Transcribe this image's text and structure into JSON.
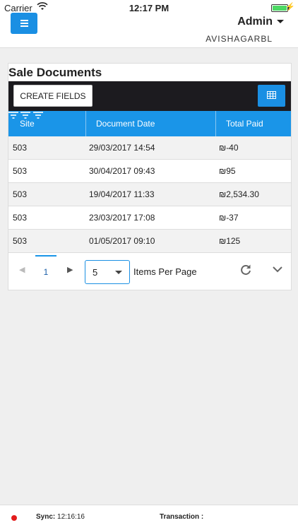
{
  "status_bar": {
    "carrier": "Carrier",
    "time": "12:17 PM"
  },
  "header": {
    "user": "Admin",
    "company": "AVISHAGARBL"
  },
  "panel": {
    "title": "Sale Documents",
    "create_fields_label": "CREATE FIELDS",
    "columns": [
      "Site",
      "Document Date",
      "Total Paid"
    ],
    "rows": [
      {
        "site": "503",
        "date": "29/03/2017 14:54",
        "total": "₪-40"
      },
      {
        "site": "503",
        "date": "30/04/2017 09:43",
        "total": "₪95"
      },
      {
        "site": "503",
        "date": "19/04/2017 11:33",
        "total": "₪2,534.30"
      },
      {
        "site": "503",
        "date": "23/03/2017 17:08",
        "total": "₪-37"
      },
      {
        "site": "503",
        "date": "01/05/2017 09:10",
        "total": "₪125"
      }
    ]
  },
  "pager": {
    "page": "1",
    "page_size": "5",
    "items_per_page_label": "Items Per Page"
  },
  "footer": {
    "sync_label": "Sync:",
    "sync_time": "12:16:16",
    "transaction_label": "Transaction :"
  },
  "colors": {
    "accent": "#1a8fe3",
    "header_row": "#1a95e8",
    "toolbar": "#1c1b1f",
    "status_dot": "#e31c1c"
  }
}
